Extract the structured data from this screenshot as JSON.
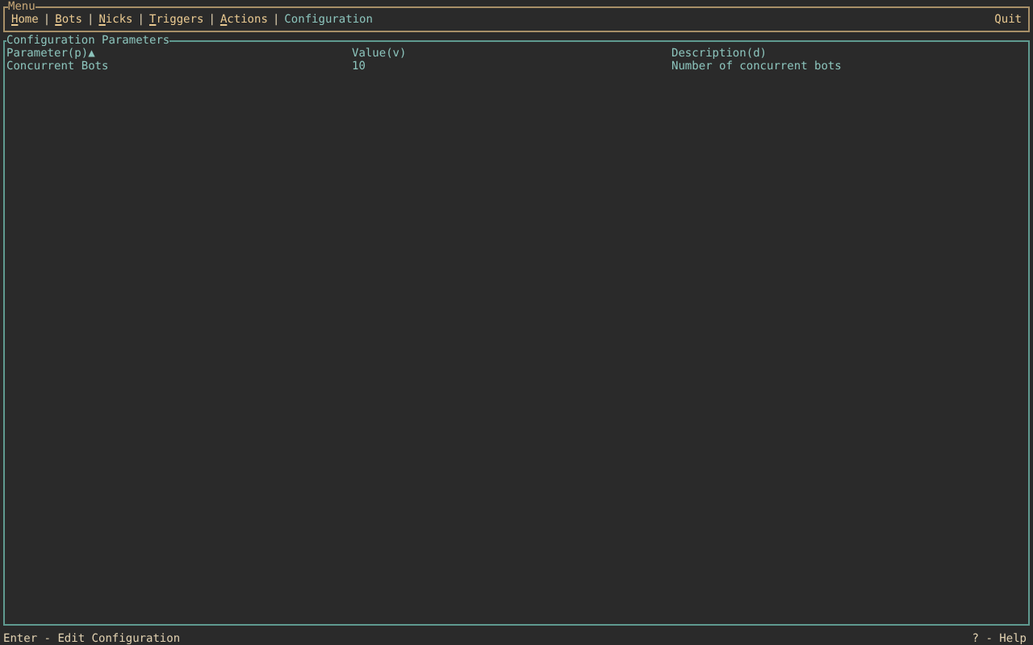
{
  "menu": {
    "title": "Menu",
    "items": [
      {
        "label": "Home",
        "hotkey": true,
        "selected": false
      },
      {
        "label": "Bots",
        "hotkey": true,
        "selected": false
      },
      {
        "label": "Nicks",
        "hotkey": true,
        "selected": false
      },
      {
        "label": "Triggers",
        "hotkey": true,
        "selected": false
      },
      {
        "label": "Actions",
        "hotkey": true,
        "selected": false
      },
      {
        "label": "Configuration",
        "hotkey": false,
        "selected": true
      }
    ],
    "separator": "|",
    "quit": "Quit"
  },
  "panel": {
    "title": "Configuration Parameters",
    "columns": [
      "Parameter(p)▲",
      "Value(v)",
      "Description(d)"
    ],
    "rows": [
      [
        "Concurrent Bots",
        "10",
        "Number of concurrent bots"
      ]
    ]
  },
  "status_bar": {
    "left": "Enter - Edit Configuration",
    "right": "? - Help"
  }
}
